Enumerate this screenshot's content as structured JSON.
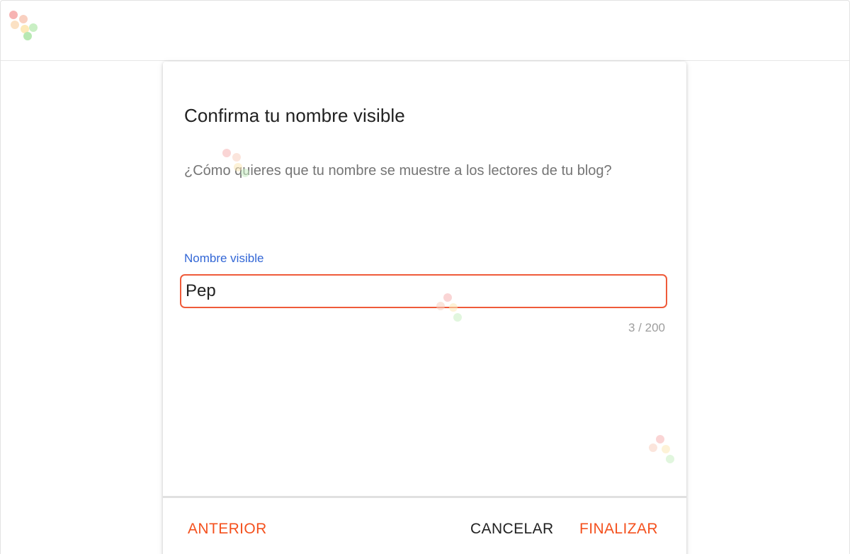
{
  "dialog": {
    "title": "Confirma tu nombre visible",
    "description": "¿Cómo quieres que tu nombre se muestre a los lectores de tu blog?",
    "field": {
      "label": "Nombre visible",
      "value": "Pep",
      "counter": "3 / 200"
    },
    "buttons": {
      "previous": "ANTERIOR",
      "cancel": "CANCELAR",
      "finish": "FINALIZAR"
    }
  },
  "colors": {
    "accent": "#f4511e",
    "label_blue": "#3367d6",
    "highlight_border": "#ef5b3a"
  }
}
